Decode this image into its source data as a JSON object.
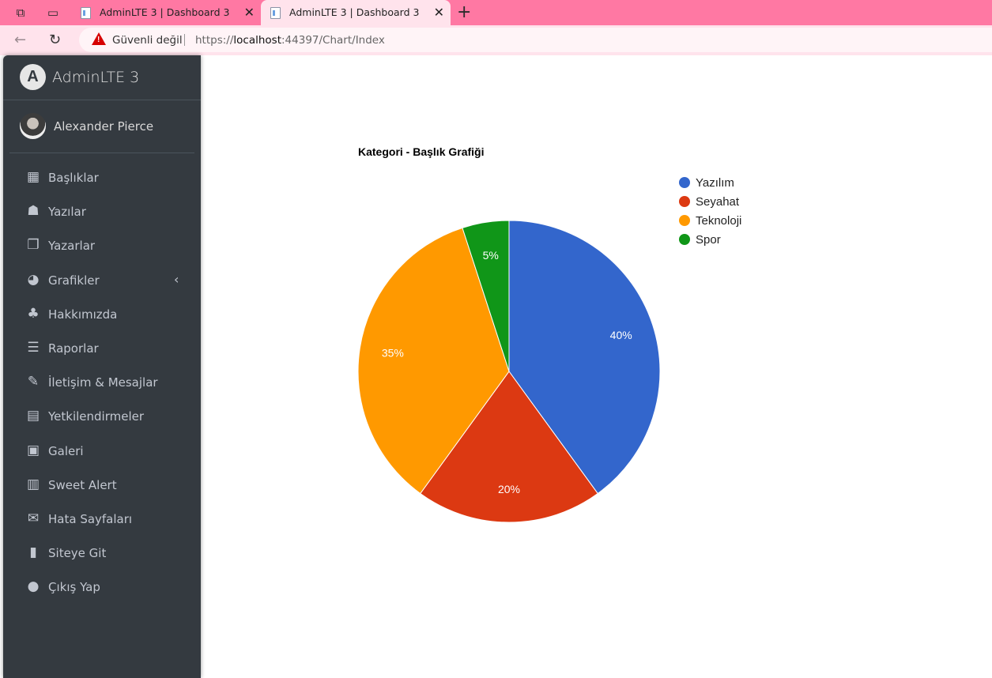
{
  "browser": {
    "tabs": [
      {
        "title": "AdminLTE 3 | Dashboard 3"
      },
      {
        "title": "AdminLTE 3 | Dashboard 3"
      }
    ],
    "security_label": "Güvenli değil",
    "url_prefix": "https://",
    "url_host": "localhost",
    "url_rest": ":44397/Chart/Index"
  },
  "sidebar": {
    "brand": "AdminLTE 3",
    "user": "Alexander Pierce",
    "items": [
      {
        "label": "Başlıklar",
        "icon": "grid-icon"
      },
      {
        "label": "Yazılar",
        "icon": "reader-icon"
      },
      {
        "label": "Yazarlar",
        "icon": "copy-icon"
      },
      {
        "label": "Grafikler",
        "icon": "pie-chart-icon"
      },
      {
        "label": "Hakkımızda",
        "icon": "tree-icon"
      },
      {
        "label": "Raporlar",
        "icon": "bars-icon"
      },
      {
        "label": "İletişim & Mesajlar",
        "icon": "edit-icon"
      },
      {
        "label": "Yetkilendirmeler",
        "icon": "calendar-icon"
      },
      {
        "label": "Galeri",
        "icon": "image-icon"
      },
      {
        "label": "Sweet Alert",
        "icon": "map-icon"
      },
      {
        "label": "Hata Sayfaları",
        "icon": "envelope-icon"
      },
      {
        "label": "Siteye Git",
        "icon": "book-icon"
      },
      {
        "label": "Çıkış Yap",
        "icon": "apple-icon"
      }
    ]
  },
  "chart_data": {
    "type": "pie",
    "title": "Kategori - Başlık Grafiği",
    "categories": [
      "Yazılım",
      "Seyahat",
      "Teknoloji",
      "Spor"
    ],
    "values": [
      40,
      20,
      35,
      5
    ],
    "labels": [
      "40%",
      "20%",
      "35%",
      "5%"
    ],
    "colors": [
      "#3366cc",
      "#dc3912",
      "#ff9900",
      "#109618"
    ],
    "legend": "right"
  }
}
